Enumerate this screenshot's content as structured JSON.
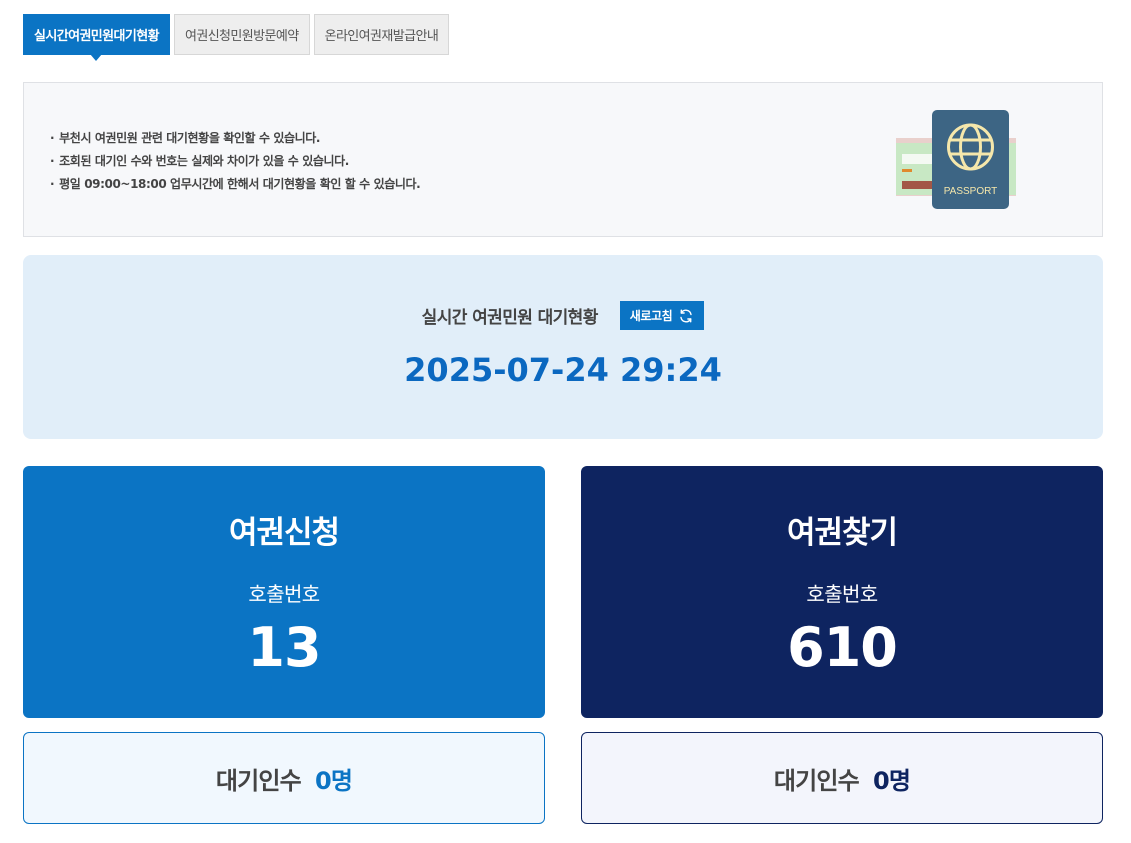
{
  "tabs": [
    {
      "label": "실시간여권민원대기현황",
      "active": true
    },
    {
      "label": "여권신청민원방문예약",
      "active": false
    },
    {
      "label": "온라인여권재발급안내",
      "active": false
    }
  ],
  "notice": {
    "items": [
      "부천시 여권민원 관련 대기현황을 확인할 수 있습니다.",
      "조회된 대기인 수와 번호는 실제와 차이가 있을 수 있습니다.",
      "평일 09:00~18:00 업무시간에 한해서 대기현황을 확인 할 수 있습니다."
    ],
    "passport_label": "PASSPORT"
  },
  "status": {
    "title": "실시간 여권민원 대기현황",
    "refresh_label": "새로고침",
    "datetime": "2025-07-24 29:24"
  },
  "cards": {
    "apply": {
      "title": "여권신청",
      "sub": "호출번호",
      "number": "13"
    },
    "find": {
      "title": "여권찾기",
      "sub": "호출번호",
      "number": "610"
    }
  },
  "waiting": {
    "apply": {
      "label": "대기인수",
      "count": "0명"
    },
    "find": {
      "label": "대기인수",
      "count": "0명"
    }
  },
  "colors": {
    "primary": "#0b74c4",
    "navy": "#0e2460",
    "panel_bg": "#e1eef9",
    "time_color": "#0b68c0"
  }
}
